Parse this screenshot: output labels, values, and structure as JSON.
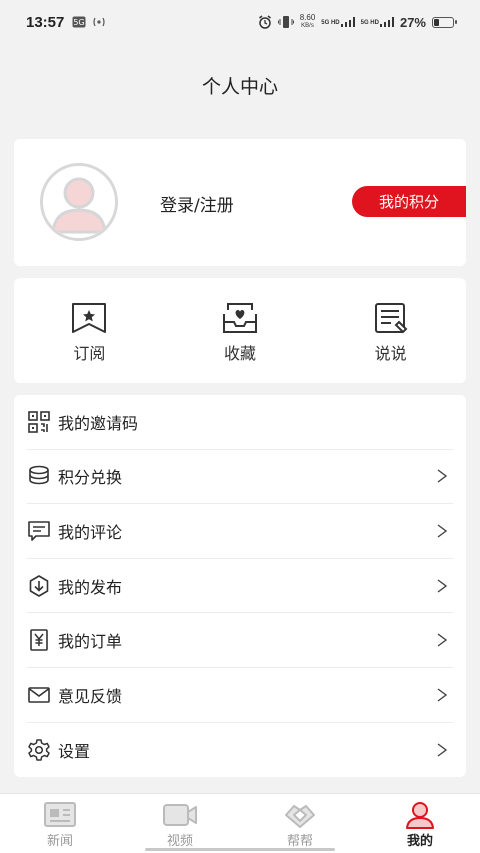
{
  "status_bar": {
    "time": "13:57",
    "net_speed_value": "8.60",
    "net_speed_unit": "KB/s",
    "sim1": "5G HD",
    "sim2": "5G HD",
    "battery_text": "27%",
    "battery_level": 0.27,
    "icons": [
      "notification-icon",
      "nfc-icon",
      "alarm-icon",
      "vibrate-icon",
      "signal-icon",
      "battery-icon"
    ]
  },
  "page": {
    "title": "个人中心"
  },
  "profile": {
    "login_text": "登录/注册",
    "points_button": "我的积分",
    "accent_color": "#e0141e"
  },
  "shortcuts": [
    {
      "label": "订阅",
      "icon": "bookmark-star-icon"
    },
    {
      "label": "收藏",
      "icon": "inbox-heart-icon"
    },
    {
      "label": "说说",
      "icon": "note-edit-icon"
    }
  ],
  "menu": [
    {
      "label": "我的邀请码",
      "icon": "qr-code-icon",
      "has_chevron": false
    },
    {
      "label": "积分兑换",
      "icon": "coins-icon",
      "has_chevron": true
    },
    {
      "label": "我的评论",
      "icon": "comment-icon",
      "has_chevron": true
    },
    {
      "label": "我的发布",
      "icon": "download-circle-icon",
      "has_chevron": true
    },
    {
      "label": "我的订单",
      "icon": "yen-receipt-icon",
      "has_chevron": true
    },
    {
      "label": "意见反馈",
      "icon": "mail-icon",
      "has_chevron": true
    },
    {
      "label": "设置",
      "icon": "gear-icon",
      "has_chevron": true
    }
  ],
  "tabs": [
    {
      "label": "新闻",
      "icon": "news-icon",
      "active": false
    },
    {
      "label": "视频",
      "icon": "video-icon",
      "active": false
    },
    {
      "label": "帮帮",
      "icon": "handshake-icon",
      "active": false
    },
    {
      "label": "我的",
      "icon": "user-icon",
      "active": true
    }
  ]
}
